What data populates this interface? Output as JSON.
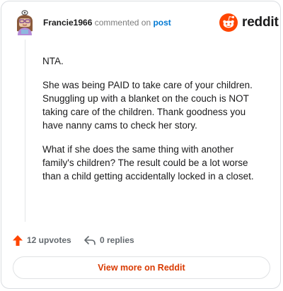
{
  "comment": {
    "author": "Francie1966",
    "action_text": "commented on",
    "post_link": "post",
    "body": [
      "NTA.",
      "She was being PAID to take care of your children. Snuggling up with a blanket on the couch is NOT taking care of the children. Thank goodness you have nanny cams to check her story.",
      "What if she does the same thing with another family's children? The result could be a lot worse than a child getting accidentally locked in a closet."
    ]
  },
  "brand": {
    "name": "reddit",
    "icon": "reddit-alien-icon",
    "color": "#ff4500"
  },
  "stats": {
    "upvotes_label": "12 upvotes",
    "upvote_icon": "upvote-arrow-icon",
    "replies_label": "0 replies",
    "reply_icon": "reply-arrow-icon"
  },
  "actions": {
    "view_more_label": "View more on Reddit"
  },
  "colors": {
    "accent": "#d93a00",
    "link": "#0079d3",
    "text": "#1a1a1b",
    "muted": "#7c7c7c"
  }
}
